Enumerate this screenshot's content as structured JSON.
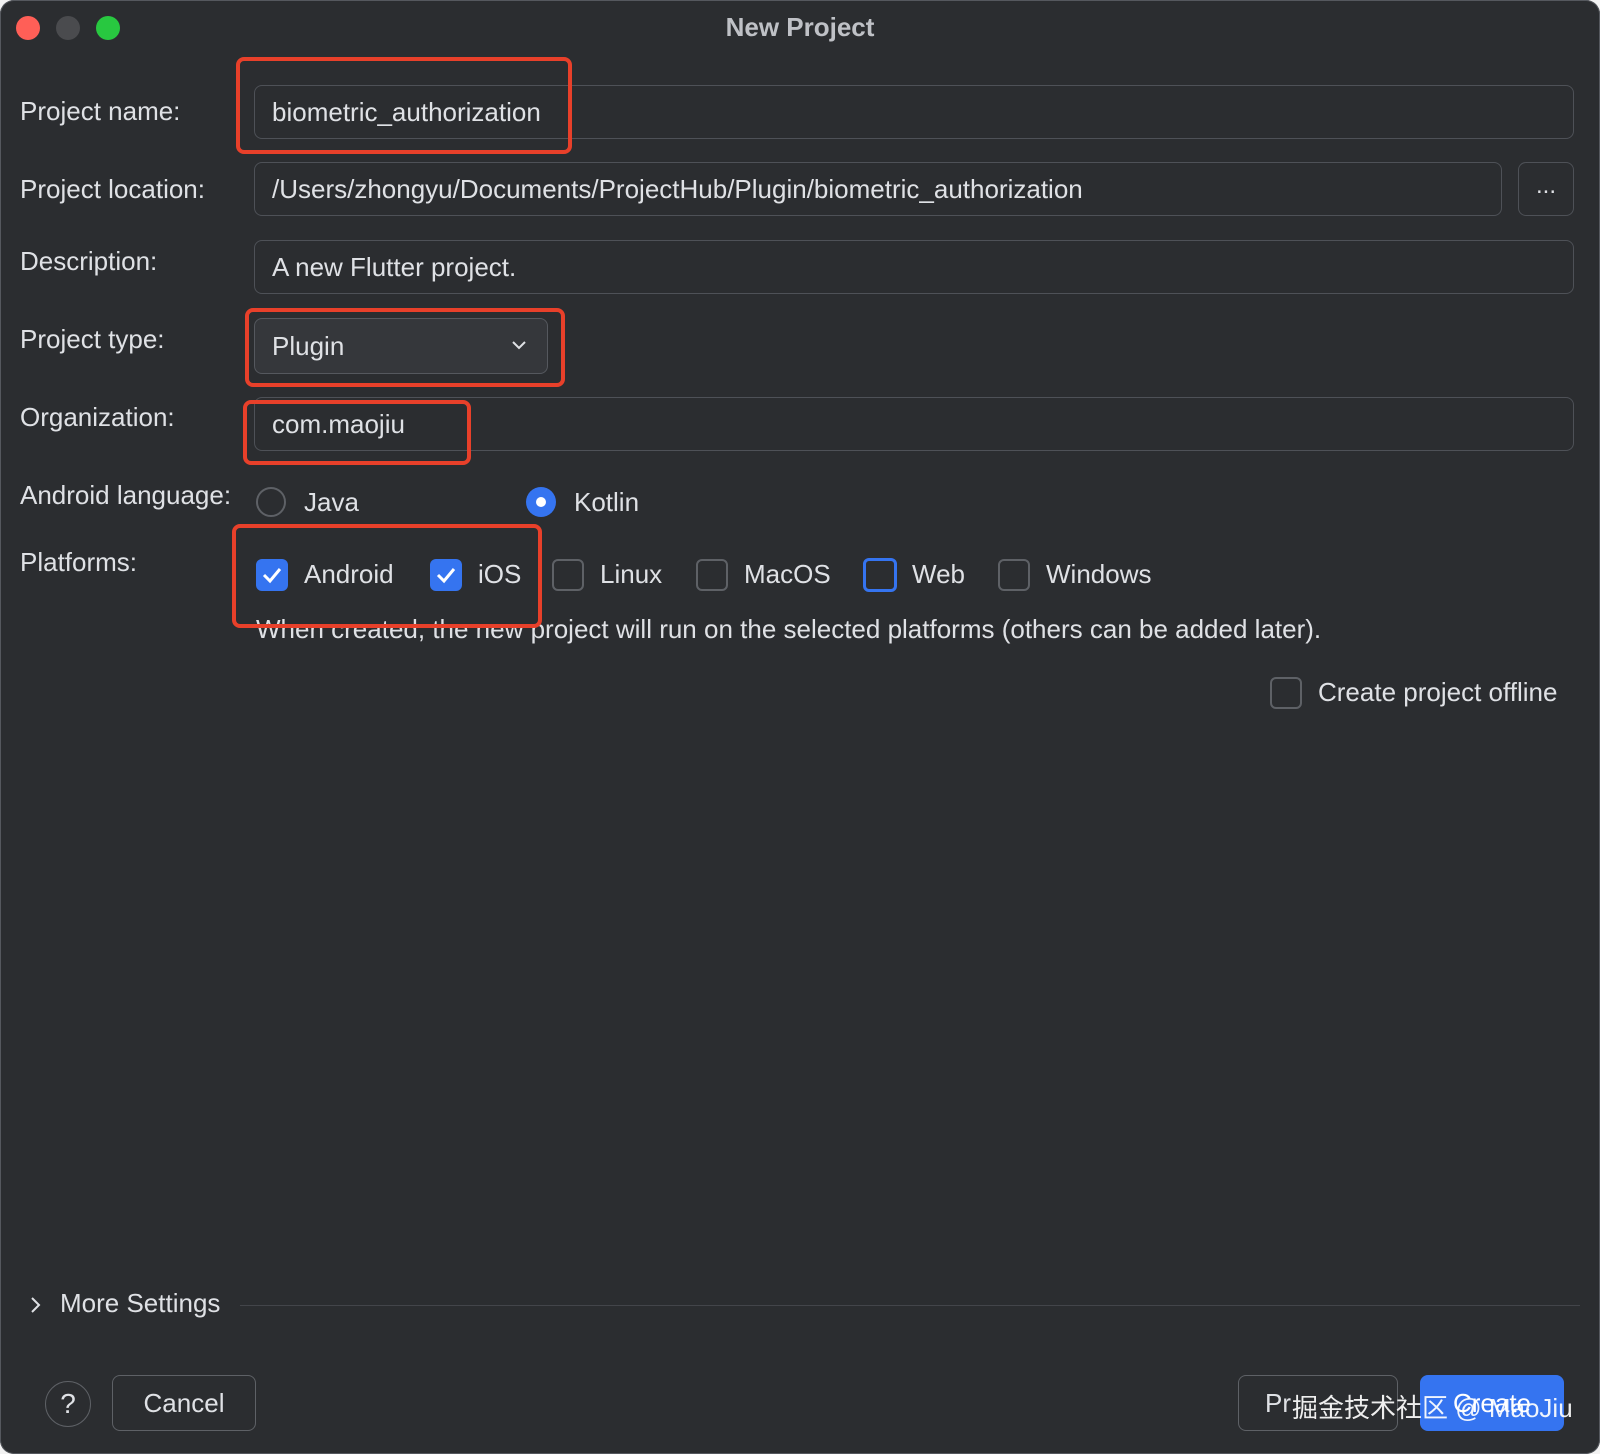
{
  "window": {
    "title": "New Project"
  },
  "form": {
    "project_name": {
      "label": "Project name:",
      "value": "biometric_authorization"
    },
    "project_location": {
      "label": "Project location:",
      "value": "/Users/zhongyu/Documents/ProjectHub/Plugin/biometric_authorization",
      "browse_label": "..."
    },
    "description": {
      "label": "Description:",
      "value": "A new Flutter project."
    },
    "project_type": {
      "label": "Project type:",
      "selected": "Plugin"
    },
    "organization": {
      "label": "Organization:",
      "value": "com.maojiu"
    },
    "android_language": {
      "label": "Android language:",
      "options": [
        {
          "label": "Java",
          "selected": false
        },
        {
          "label": "Kotlin",
          "selected": true
        }
      ]
    },
    "platforms": {
      "label": "Platforms:",
      "options": [
        {
          "label": "Android",
          "checked": true
        },
        {
          "label": "iOS",
          "checked": true
        },
        {
          "label": "Linux",
          "checked": false
        },
        {
          "label": "MacOS",
          "checked": false
        },
        {
          "label": "Web",
          "checked": false
        },
        {
          "label": "Windows",
          "checked": false
        }
      ],
      "hint": "When created, the new project will run on the selected platforms (others can be added later)."
    },
    "offline": {
      "label": "Create project offline",
      "checked": false
    }
  },
  "more_settings": {
    "label": "More Settings"
  },
  "footer": {
    "help_label": "?",
    "cancel_label": "Cancel",
    "previous_label": "Pr",
    "create_label": "Create"
  },
  "watermark": "掘金技术社区 @ MaoJiu",
  "colors": {
    "background": "#2b2d30",
    "accent": "#3574f0",
    "highlight": "#e8402a"
  }
}
